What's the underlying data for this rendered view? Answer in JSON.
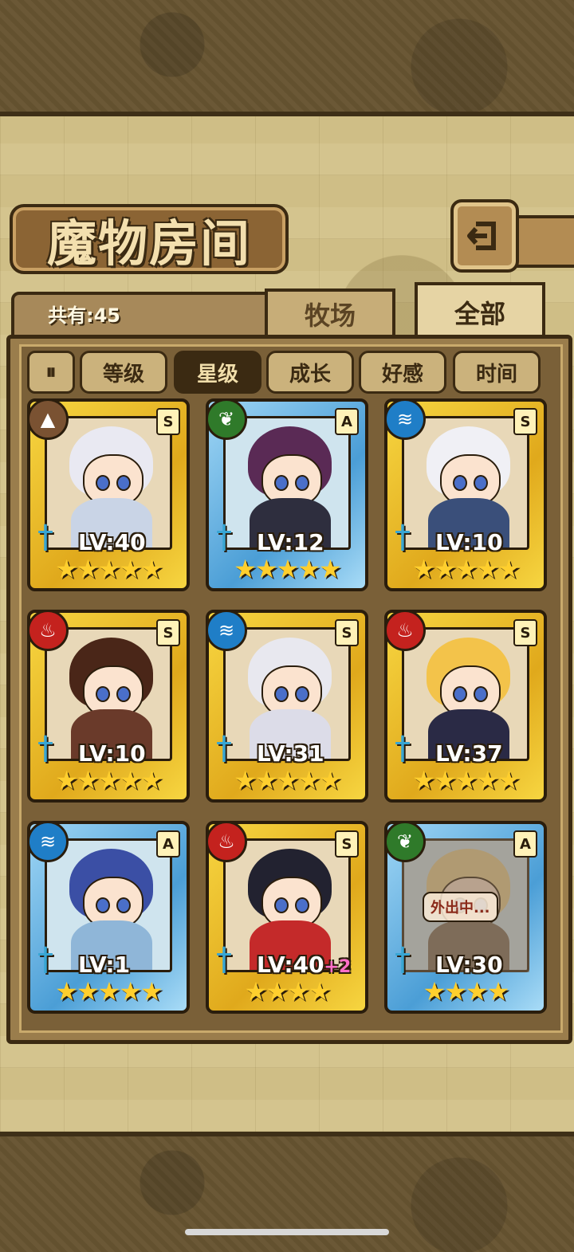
{
  "header": {
    "title": "魔物房间",
    "count_label": "共有:45"
  },
  "tabs": [
    {
      "label": "牧场"
    },
    {
      "label": "全部"
    }
  ],
  "sort": {
    "toggle_label": "⏸",
    "buttons": [
      {
        "label": "等级"
      },
      {
        "label": "星级"
      },
      {
        "label": "成长"
      },
      {
        "label": "好感"
      },
      {
        "label": "时间"
      }
    ],
    "active": "星级"
  },
  "cards": [
    {
      "frame": "gold",
      "element": "earth",
      "rank": "S",
      "level": "LV:40",
      "level_bonus": "",
      "stars": "★★★★★",
      "status": ""
    },
    {
      "frame": "blue",
      "element": "wood",
      "rank": "A",
      "level": "LV:12",
      "level_bonus": "",
      "stars": "★★★★★",
      "status": ""
    },
    {
      "frame": "gold",
      "element": "water",
      "rank": "S",
      "level": "LV:10",
      "level_bonus": "",
      "stars": "★★★★★",
      "status": ""
    },
    {
      "frame": "gold",
      "element": "fire",
      "rank": "S",
      "level": "LV:10",
      "level_bonus": "",
      "stars": "★★★★★",
      "status": ""
    },
    {
      "frame": "gold",
      "element": "water",
      "rank": "S",
      "level": "LV:31",
      "level_bonus": "",
      "stars": "★★★★★",
      "status": ""
    },
    {
      "frame": "gold",
      "element": "fire",
      "rank": "S",
      "level": "LV:37",
      "level_bonus": "",
      "stars": "★★★★★",
      "status": ""
    },
    {
      "frame": "blue",
      "element": "water",
      "rank": "A",
      "level": "LV:1",
      "level_bonus": "",
      "stars": "★★★★★",
      "status": ""
    },
    {
      "frame": "gold",
      "element": "fire",
      "rank": "S",
      "level": "LV:40",
      "level_bonus": "+2",
      "stars": "★★★★",
      "status": ""
    },
    {
      "frame": "blue",
      "element": "wood",
      "rank": "A",
      "level": "LV:30",
      "level_bonus": "",
      "stars": "★★★★",
      "status": "外出中..."
    }
  ],
  "icons": {
    "back": "return-arrow-icon",
    "earth": "mountain-icon",
    "wood": "leaf-icon",
    "water": "wave-icon",
    "fire": "flame-icon",
    "weapon": "sword-icon"
  }
}
